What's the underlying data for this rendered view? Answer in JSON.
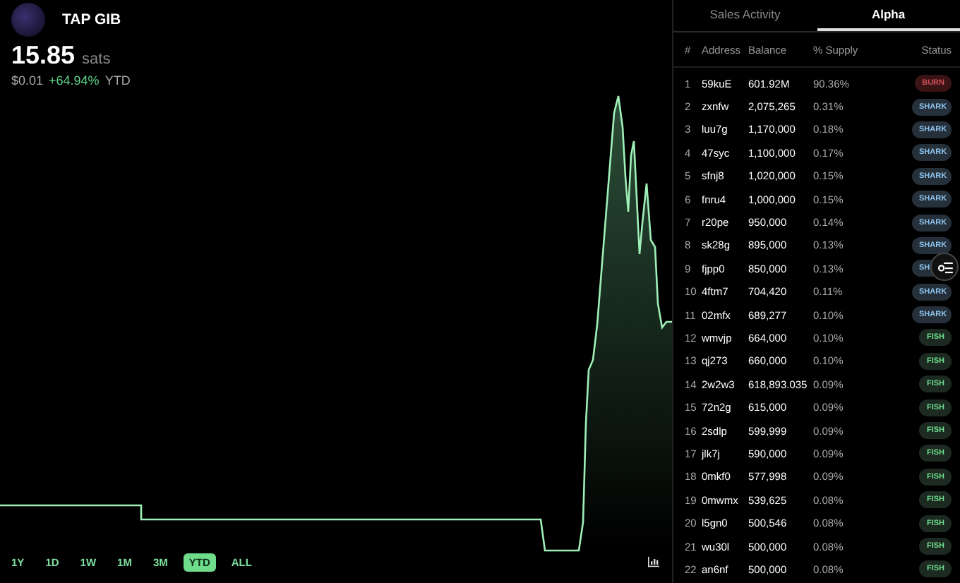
{
  "token": {
    "name": "TAP GIB",
    "price": "15.85",
    "unit": "sats",
    "usd": "$0.01",
    "change": "+64.94%",
    "period": "YTD"
  },
  "ranges": [
    {
      "label": "1Y",
      "selected": false
    },
    {
      "label": "1D",
      "selected": false
    },
    {
      "label": "1W",
      "selected": false
    },
    {
      "label": "1M",
      "selected": false
    },
    {
      "label": "3M",
      "selected": false
    },
    {
      "label": "YTD",
      "selected": true
    },
    {
      "label": "ALL",
      "selected": false
    }
  ],
  "tabs": [
    {
      "label": "Sales Activity",
      "selected": false
    },
    {
      "label": "Alpha",
      "selected": true
    }
  ],
  "table": {
    "columns": [
      "#",
      "Address",
      "Balance",
      "% Supply",
      "Status"
    ],
    "rows": [
      {
        "rank": "1",
        "address": "59kuE",
        "balance": "601.92M",
        "supply": "90.36%",
        "status": "BURN",
        "kind": "burn"
      },
      {
        "rank": "2",
        "address": "zxnfw",
        "balance": "2,075,265",
        "supply": "0.31%",
        "status": "SHARK",
        "kind": "shark"
      },
      {
        "rank": "3",
        "address": "luu7g",
        "balance": "1,170,000",
        "supply": "0.18%",
        "status": "SHARK",
        "kind": "shark"
      },
      {
        "rank": "4",
        "address": "47syc",
        "balance": "1,100,000",
        "supply": "0.17%",
        "status": "SHARK",
        "kind": "shark"
      },
      {
        "rank": "5",
        "address": "sfnj8",
        "balance": "1,020,000",
        "supply": "0.15%",
        "status": "SHARK",
        "kind": "shark"
      },
      {
        "rank": "6",
        "address": "fnru4",
        "balance": "1,000,000",
        "supply": "0.15%",
        "status": "SHARK",
        "kind": "shark"
      },
      {
        "rank": "7",
        "address": "r20pe",
        "balance": "950,000",
        "supply": "0.14%",
        "status": "SHARK",
        "kind": "shark"
      },
      {
        "rank": "8",
        "address": "sk28g",
        "balance": "895,000",
        "supply": "0.13%",
        "status": "SHARK",
        "kind": "shark"
      },
      {
        "rank": "9",
        "address": "fjpp0",
        "balance": "850,000",
        "supply": "0.13%",
        "status": "SH",
        "kind": "shark"
      },
      {
        "rank": "10",
        "address": "4ftm7",
        "balance": "704,420",
        "supply": "0.11%",
        "status": "SHARK",
        "kind": "shark"
      },
      {
        "rank": "11",
        "address": "02mfx",
        "balance": "689,277",
        "supply": "0.10%",
        "status": "SHARK",
        "kind": "shark"
      },
      {
        "rank": "12",
        "address": "wmvjp",
        "balance": "664,000",
        "supply": "0.10%",
        "status": "FISH",
        "kind": "fish"
      },
      {
        "rank": "13",
        "address": "qj273",
        "balance": "660,000",
        "supply": "0.10%",
        "status": "FISH",
        "kind": "fish"
      },
      {
        "rank": "14",
        "address": "2w2w3",
        "balance": "618,893.035",
        "supply": "0.09%",
        "status": "FISH",
        "kind": "fish"
      },
      {
        "rank": "15",
        "address": "72n2g",
        "balance": "615,000",
        "supply": "0.09%",
        "status": "FISH",
        "kind": "fish"
      },
      {
        "rank": "16",
        "address": "2sdlp",
        "balance": "599,999",
        "supply": "0.09%",
        "status": "FISH",
        "kind": "fish"
      },
      {
        "rank": "17",
        "address": "jlk7j",
        "balance": "590,000",
        "supply": "0.09%",
        "status": "FISH",
        "kind": "fish"
      },
      {
        "rank": "18",
        "address": "0mkf0",
        "balance": "577,998",
        "supply": "0.09%",
        "status": "FISH",
        "kind": "fish"
      },
      {
        "rank": "19",
        "address": "0mwmx",
        "balance": "539,625",
        "supply": "0.08%",
        "status": "FISH",
        "kind": "fish"
      },
      {
        "rank": "20",
        "address": "l5gn0",
        "balance": "500,546",
        "supply": "0.08%",
        "status": "FISH",
        "kind": "fish"
      },
      {
        "rank": "21",
        "address": "wu30l",
        "balance": "500,000",
        "supply": "0.08%",
        "status": "FISH",
        "kind": "fish"
      },
      {
        "rank": "22",
        "address": "an6nf",
        "balance": "500,000",
        "supply": "0.08%",
        "status": "FISH",
        "kind": "fish"
      }
    ]
  }
}
